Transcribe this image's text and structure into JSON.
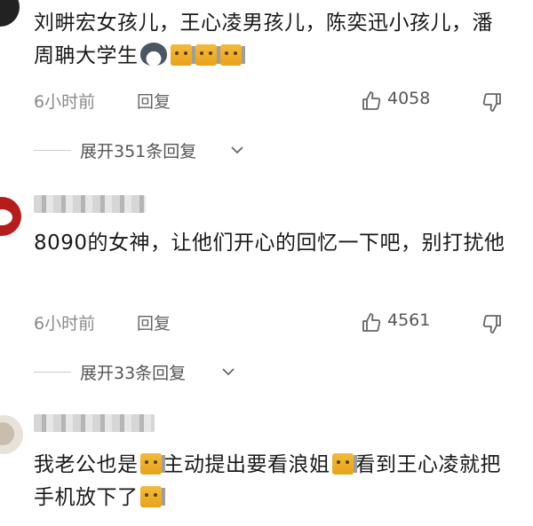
{
  "comments": [
    {
      "text_parts": [
        "刘畊宏女孩儿，王心凌男孩儿，陈奕迅小孩儿，潘周聃大学生"
      ],
      "time": "6小时前",
      "reply_label": "回复",
      "likes": "4058",
      "expand_label": "展开351条回复"
    },
    {
      "text_parts": [
        "8090的女神，让他们开心的回忆一下吧，别打扰他"
      ],
      "time": "6小时前",
      "reply_label": "回复",
      "likes": "4561",
      "expand_label": "展开33条回复"
    },
    {
      "text_parts": [
        "我老公也是",
        "主动提出要看浪姐",
        "看到王心凌就把手机放下了"
      ]
    }
  ],
  "icons": {
    "like": "thumbs-up-icon",
    "dislike": "thumbs-down-icon",
    "expand": "chevron-down-icon",
    "emoji_cat": "cat-emoji-icon",
    "emoji_husky": "husky-emoji-icon"
  }
}
